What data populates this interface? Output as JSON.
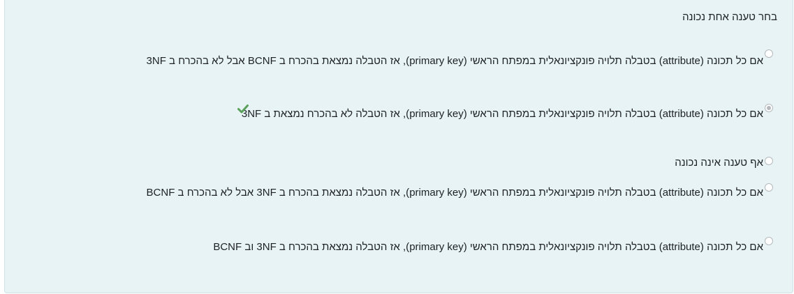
{
  "question": {
    "prompt": "בחר טענה אחת נכונה",
    "options": [
      {
        "label": "אם כל תכונה (attribute) בטבלה תלויה פונקציונאלית במפתח הראשי (primary key), אז הטבלה נמצאת בהכרח ב BCNF אבל לא בהכרח ב 3NF",
        "selected": false
      },
      {
        "label": "אם כל תכונה (attribute) בטבלה תלויה פונקציונאלית במפתח הראשי (primary key), אז הטבלה לא בהכרח נמצאת ב 3NF",
        "selected": true,
        "feedback_icon": "checkmark-icon"
      },
      {
        "label": "אף טענה אינה נכונה",
        "selected": false
      },
      {
        "label": "אם כל תכונה (attribute) בטבלה תלויה פונקציונאלית במפתח הראשי (primary key), אז הטבלה נמצאת בהכרח ב 3NF אבל לא בהכרח ב BCNF",
        "selected": false
      },
      {
        "label": "אם כל תכונה (attribute) בטבלה תלויה פונקציונאלית במפתח הראשי (primary key), אז הטבלה נמצאת בהכרח ב 3NF וב BCNF",
        "selected": false
      }
    ]
  },
  "colors": {
    "panel_background": "#e7f3f5",
    "correct_check": "#5aa05a"
  }
}
